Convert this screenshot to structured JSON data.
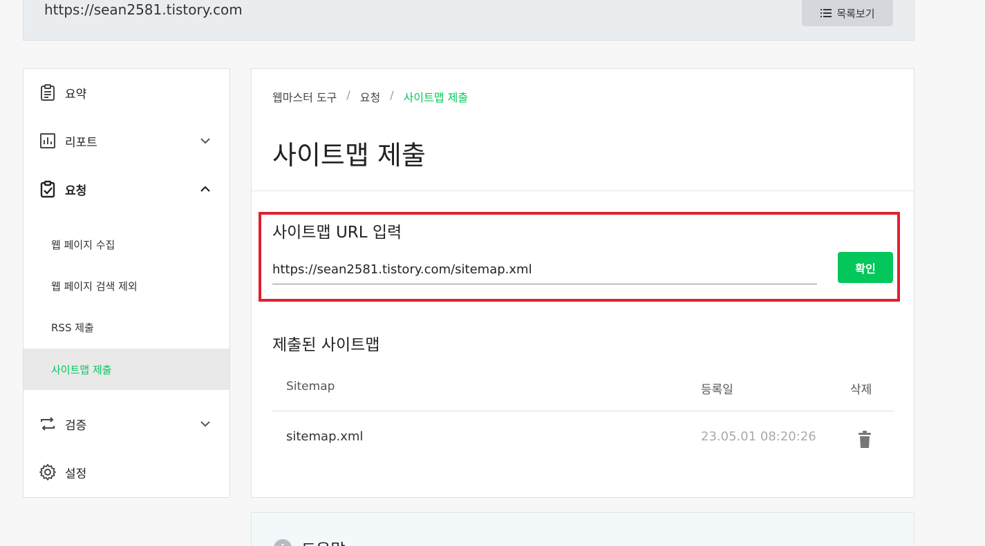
{
  "site": {
    "url": "https://sean2581.tistory.com",
    "list_button": "목록보기",
    "list_icon": "list-icon"
  },
  "sidebar": {
    "items": [
      {
        "label": "요약",
        "icon": "clipboard-icon"
      },
      {
        "label": "리포트",
        "icon": "bar-chart-icon",
        "chevron": "down"
      },
      {
        "label": "요청",
        "icon": "clipboard-check-icon",
        "chevron": "up",
        "expanded": true
      },
      {
        "label": "검증",
        "icon": "repeat-icon",
        "chevron": "down"
      },
      {
        "label": "설정",
        "icon": "gear-icon"
      }
    ],
    "subitems": [
      {
        "label": "웹 페이지 수집"
      },
      {
        "label": "웹 페이지 검색 제외"
      },
      {
        "label": "RSS 제출"
      },
      {
        "label": "사이트맵 제출",
        "active": true
      }
    ]
  },
  "main": {
    "breadcrumb": [
      "웹마스터 도구",
      "요청",
      "사이트맵 제출"
    ],
    "breadcrumb_sep": "/",
    "title": "사이트맵 제출",
    "input_section": {
      "title": "사이트맵 URL 입력",
      "value": "https://sean2581.tistory.com/sitemap.xml",
      "confirm_label": "확인"
    },
    "submitted": {
      "title": "제출된 사이트맵",
      "columns": [
        "Sitemap",
        "등록일",
        "삭제"
      ],
      "rows": [
        {
          "sitemap": "sitemap.xml",
          "date": "23.05.01 08:20:26",
          "delete_icon": "trash-icon"
        }
      ]
    }
  },
  "help": {
    "label": "도움말",
    "icon": "info-icon"
  },
  "colors": {
    "accent": "#03c75a",
    "highlight": "#e0202e"
  }
}
